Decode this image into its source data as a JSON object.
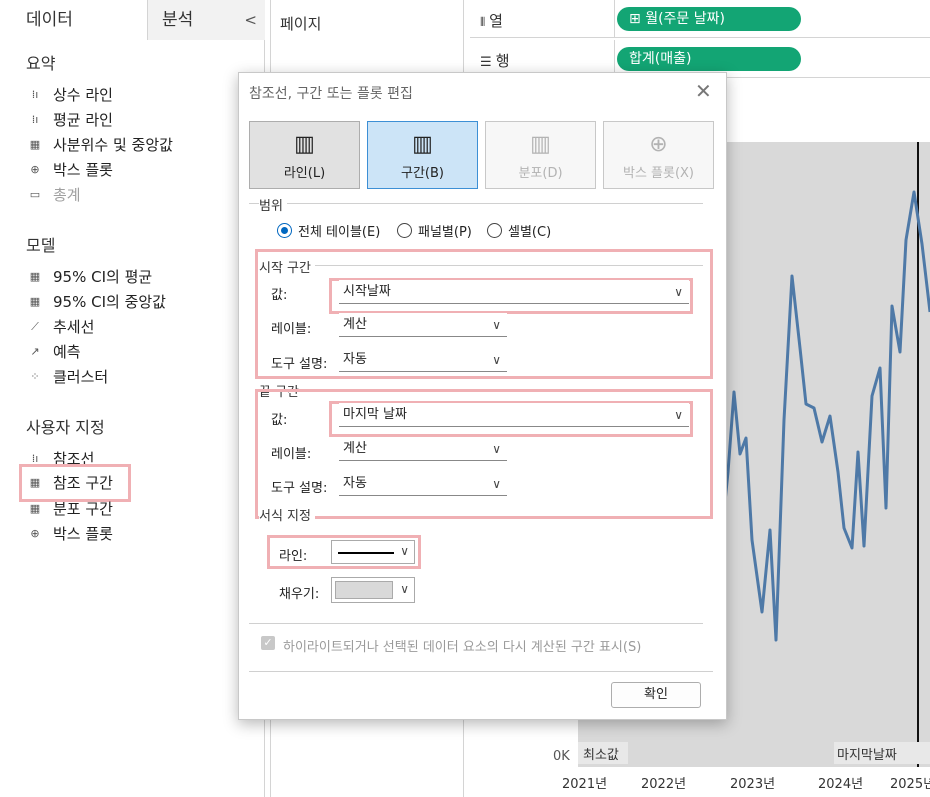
{
  "left_pane": {
    "tab_data": "데이터",
    "tab_analysis": "분석",
    "collapse_glyph": "<",
    "summary_title": "요약",
    "summary_items": [
      "상수 라인",
      "평균 라인",
      "사분위수 및 중앙값",
      "박스 플롯",
      "총계"
    ],
    "model_title": "모델",
    "model_items": [
      "95% CI의 평균",
      "95% CI의 중앙값",
      "추세선",
      "예측",
      "클러스터"
    ],
    "custom_title": "사용자 지정",
    "custom_items": [
      "참조선",
      "참조 구간",
      "분포 구간",
      "박스 플롯"
    ]
  },
  "pages": {
    "title": "페이지"
  },
  "shelves": {
    "columns_label": "열",
    "columns_pill": "월(주문 날짜)",
    "rows_label": "행",
    "rows_pill": "합계(매출)",
    "pill_color": "#13a574"
  },
  "chart_data": {
    "type": "line",
    "x_ticks": [
      "2021년",
      "2022년",
      "2023년",
      "2024년",
      "2025년"
    ],
    "y_tick": "0K",
    "band_start_label": "최소값",
    "band_end_label": "마지막날짜",
    "line_color": "#4e79a7",
    "band_color": "#d9d9d9"
  },
  "dialog": {
    "title": "참조선, 구간 또는 플롯 편집",
    "close_glyph": "✕",
    "types": [
      "라인(L)",
      "구간(B)",
      "분포(D)",
      "박스 플롯(X)"
    ],
    "selected_type": "구간(B)",
    "scope_title": "범위",
    "scope_options": [
      "전체 테이블(E)",
      "패널별(P)",
      "셀별(C)"
    ],
    "scope_selected": "전체 테이블(E)",
    "start_title": "시작 구간",
    "end_title": "끝 구간",
    "value_label": "값:",
    "label_label": "레이블:",
    "tooltip_label": "도구 설명:",
    "start_value": "시작날짜",
    "start_label_value": "계산",
    "start_tooltip_value": "자동",
    "end_value": "마지막 날짜",
    "end_label_value": "계산",
    "end_tooltip_value": "자동",
    "format_title": "서식 지정",
    "line_label": "라인:",
    "fill_label": "채우기:",
    "fill_color": "#d9d9d9",
    "highlight_checkbox": "하이라이트되거나 선택된 데이터 요소의 다시 계산된 구간 표시(S)",
    "ok": "확인",
    "highlight_color": "#f0b0b4",
    "accent_color": "#0067c0"
  }
}
